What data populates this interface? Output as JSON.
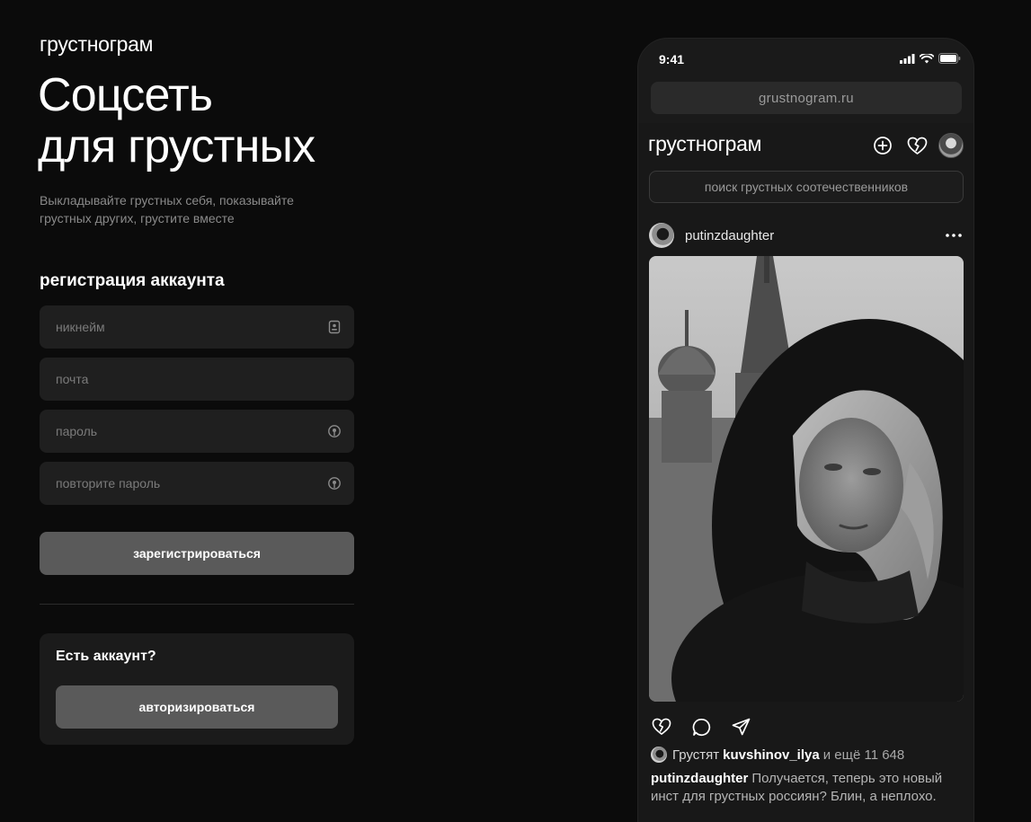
{
  "brand": "грустнограм",
  "hero": {
    "title_line1": "Соцсеть",
    "title_line2": "для грустных",
    "subtitle": "Выкладывайте грустных себя, показывайте грустных других, грустите вместе"
  },
  "registration": {
    "heading": "регистрация аккаунта",
    "fields": {
      "nickname_placeholder": "никнейм",
      "email_placeholder": "почта",
      "password_placeholder": "пароль",
      "repeat_password_placeholder": "повторите пароль"
    },
    "submit_label": "зарегистрироваться"
  },
  "login": {
    "question": "Есть аккаунт?",
    "button_label": "авторизироваться"
  },
  "phone": {
    "status_time": "9:41",
    "url": "grustnogram.ru",
    "app_logo": "грустнограм",
    "search_placeholder": "поиск грустных соотечественников",
    "post": {
      "username": "putinzdaughter",
      "likes_prefix": "Грустят",
      "likes_user": "kuvshinov_ilya",
      "likes_rest": "и ещё 11 648",
      "caption_user": "putinzdaughter",
      "caption_text": "Получается, теперь это новый инст для грустных россиян? Блин, а неплохо."
    }
  },
  "colors": {
    "background": "#0b0b0b",
    "field": "#1f1f1f",
    "button": "#5a5a5a",
    "muted_text": "#8a8a8a"
  }
}
